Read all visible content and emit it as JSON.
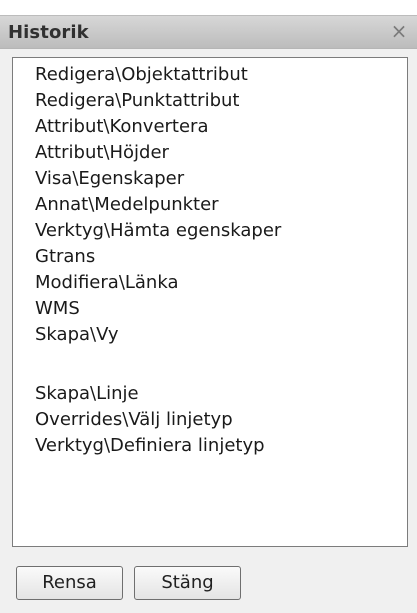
{
  "window": {
    "title": "Historik",
    "close_symbol": "×"
  },
  "history": {
    "items": [
      "Redigera\\Objektattribut",
      "Redigera\\Punktattribut",
      "Attribut\\Konvertera",
      "Attribut\\Höjder",
      "Visa\\Egenskaper",
      "Annat\\Medelpunkter",
      "Verktyg\\Hämta egenskaper",
      "Gtrans",
      "Modifiera\\Länka",
      "WMS",
      "Skapa\\Vy",
      "",
      "Skapa\\Linje",
      "Overrides\\Välj linjetyp",
      "Verktyg\\Definiera linjetyp"
    ]
  },
  "buttons": {
    "clear_label": "Rensa",
    "close_label": "Stäng"
  },
  "icons": {
    "close": "close-icon"
  }
}
